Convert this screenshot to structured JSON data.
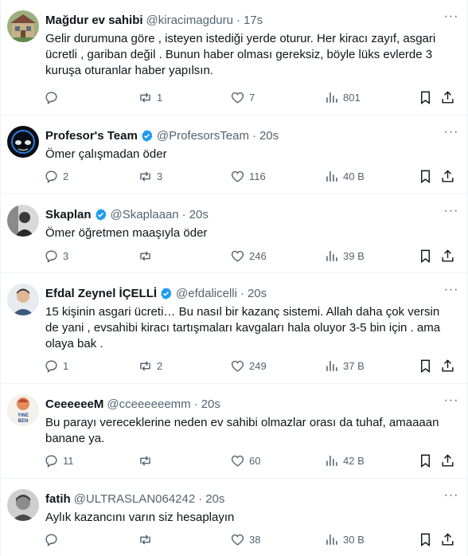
{
  "colors": {
    "text": "#0f1419",
    "muted": "#536471",
    "verified": "#1d9bf0",
    "divider": "#eff3f4"
  },
  "icons": [
    "reply-icon",
    "retweet-icon",
    "like-icon",
    "views-icon",
    "bookmark-icon",
    "share-icon",
    "more-icon",
    "verified-badge-icon"
  ],
  "tweets": [
    {
      "name": "Mağdur ev sahibi",
      "handle": "@kiracimagduru",
      "time": "17s",
      "verified": false,
      "lines": [
        "Gelir durumuna göre , isteyen istediği yerde oturur. Her kiracı zayıf, asgari",
        "ücretli , gariban değil . Bunun haber olması gereksiz, böyle lüks evlerde 3",
        "kuruşa oturanlar haber yapılsın."
      ],
      "replies": "",
      "retweets": "1",
      "likes": "7",
      "views": "801"
    },
    {
      "name": "Profesor's Team",
      "handle": "@ProfesorsTeam",
      "time": "20s",
      "verified": true,
      "lines": [
        "Ömer çalışmadan öder"
      ],
      "replies": "2",
      "retweets": "3",
      "likes": "116",
      "views": "40 B"
    },
    {
      "name": "Skaplan",
      "handle": "@Skaplaaan",
      "time": "20s",
      "verified": true,
      "lines": [
        "Ömer öğretmen maaşıyla öder"
      ],
      "replies": "3",
      "retweets": "",
      "likes": "246",
      "views": "39 B"
    },
    {
      "name": "Efdal Zeynel İÇELLİ",
      "handle": "@efdalicelli",
      "time": "20s",
      "verified": true,
      "lines": [
        "15 kişinin asgari ücreti… Bu nasıl bir kazanç sistemi. Allah daha çok versin",
        "de yani , evsahibi kiracı tartışmaları kavgaları hala oluyor 3-5 bin için . ama",
        "olaya bak ."
      ],
      "replies": "1",
      "retweets": "2",
      "likes": "249",
      "views": "37 B"
    },
    {
      "name": "CeeeeeeM",
      "handle": "@cceeeeeemm",
      "time": "20s",
      "verified": false,
      "avatar_text": [
        "YINE",
        "BEN"
      ],
      "lines": [
        "Bu parayı vereceklerine neden ev sahibi olmazlar orası da tuhaf, amaaaan",
        "banane ya."
      ],
      "replies": "11",
      "retweets": "",
      "likes": "60",
      "views": "42 B"
    },
    {
      "name": "fatih",
      "handle": "@ULTRASLAN064242",
      "time": "20s",
      "verified": false,
      "lines": [
        "Aylık kazancını varın siz hesaplayın"
      ],
      "replies": "",
      "retweets": "",
      "likes": "38",
      "views": "30 B"
    }
  ]
}
